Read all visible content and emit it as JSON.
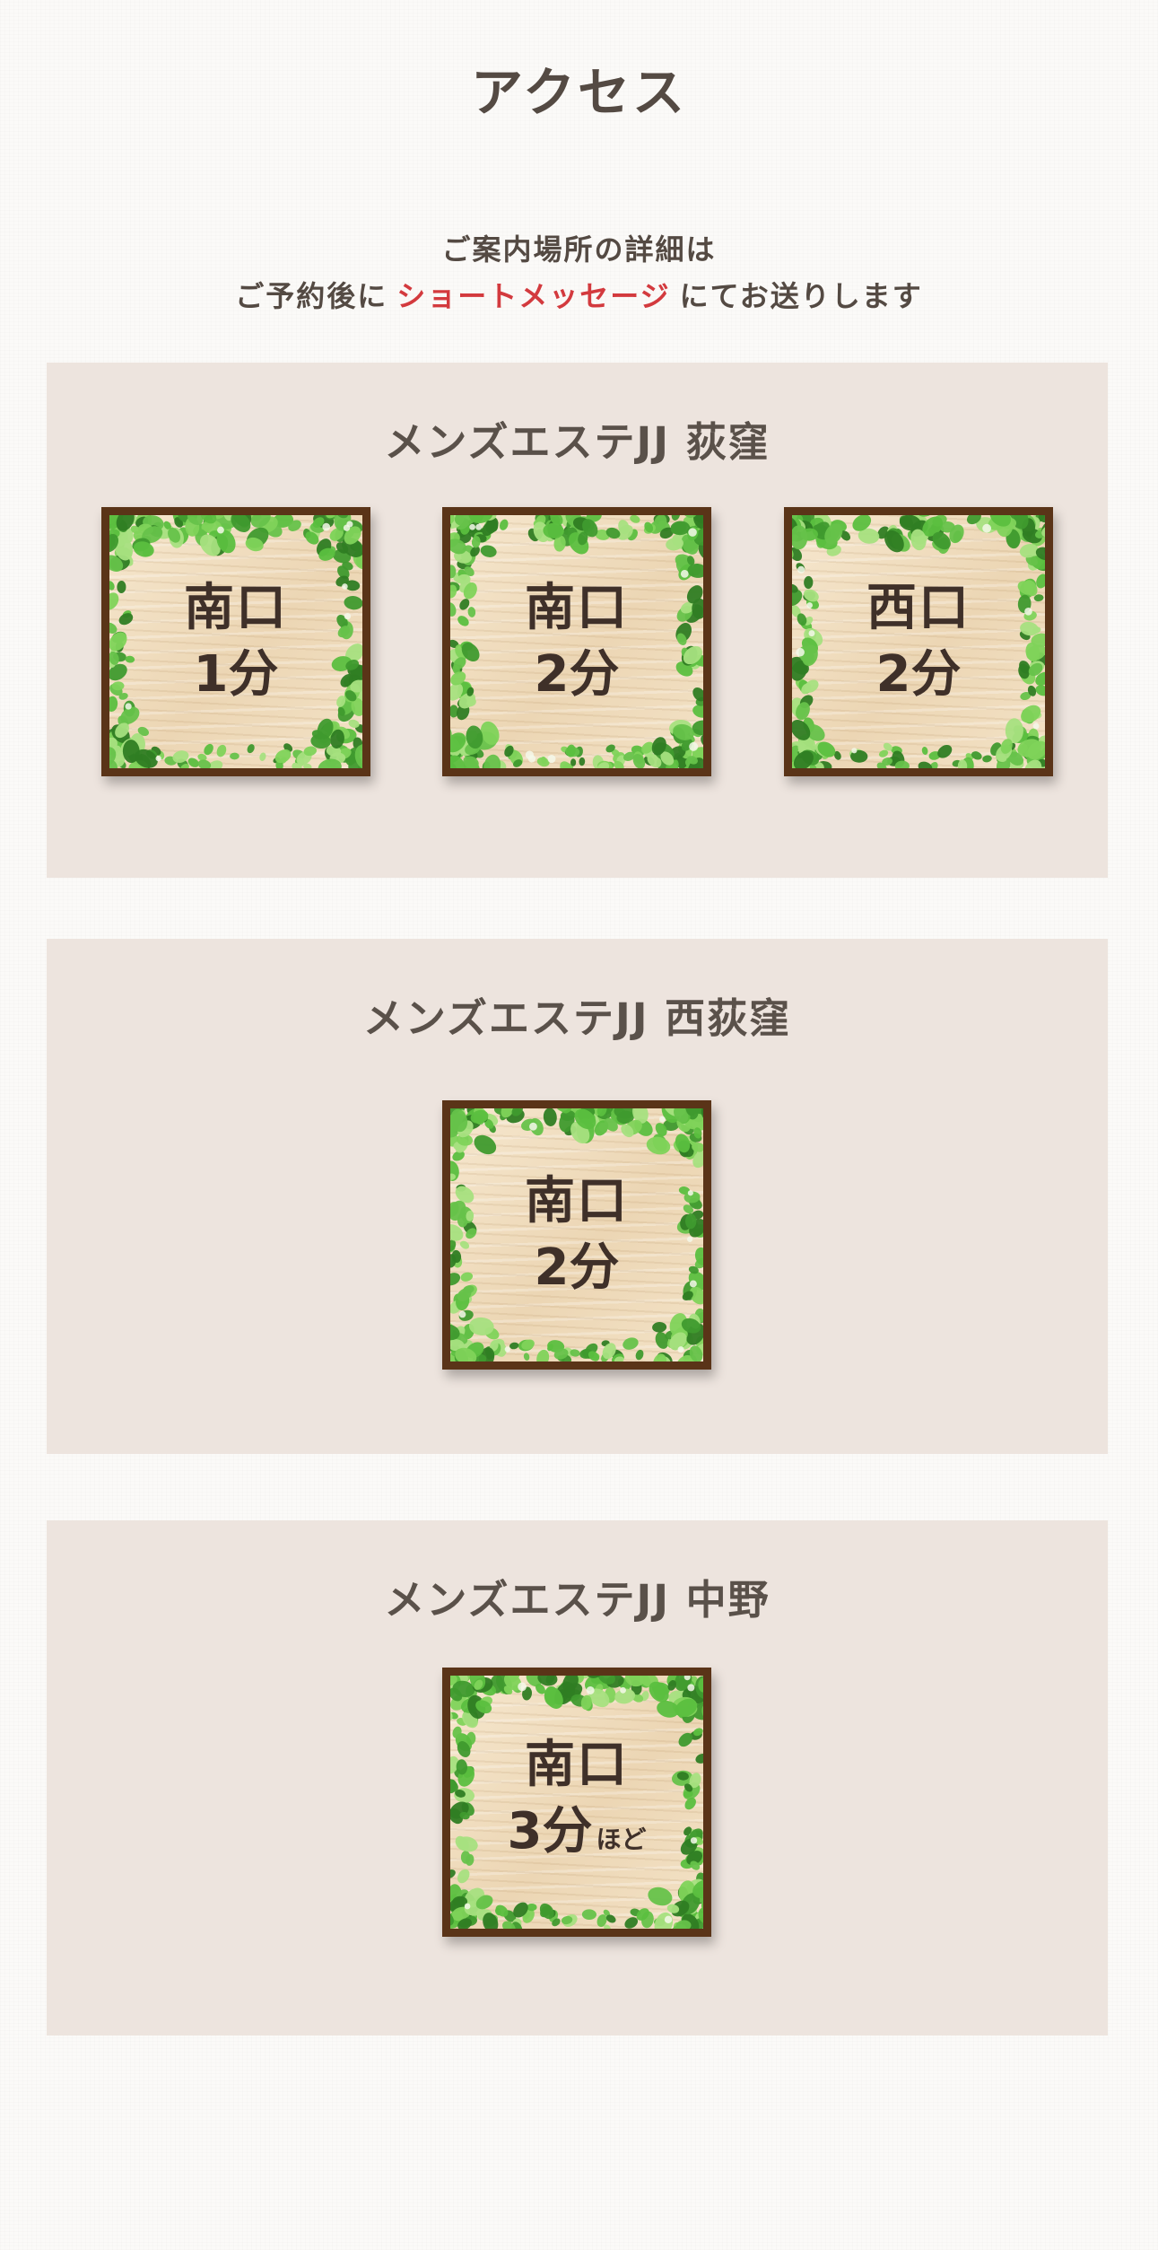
{
  "page": {
    "title": "アクセス"
  },
  "intro": {
    "line1": "ご案内場所の詳細は",
    "line2_prefix": "ご予約後に",
    "line2_highlight": "ショートメッセージ",
    "line2_suffix": "にてお送りします",
    "highlight_color": "#d33a3e"
  },
  "stores": [
    {
      "name": "メンズエステJJ 荻窪",
      "signs": [
        {
          "exit": "南口",
          "time": "1分",
          "note": ""
        },
        {
          "exit": "南口",
          "time": "2分",
          "note": ""
        },
        {
          "exit": "西口",
          "time": "2分",
          "note": ""
        }
      ]
    },
    {
      "name": "メンズエステJJ 西荻窪",
      "signs": [
        {
          "exit": "南口",
          "time": "2分",
          "note": ""
        }
      ]
    },
    {
      "name": "メンズエステJJ 中野",
      "signs": [
        {
          "exit": "南口",
          "time": "3分",
          "note": "ほど"
        }
      ]
    }
  ],
  "colors": {
    "section_background": "#ede4de",
    "sign_frame": "#5a3418",
    "leaf_green": "#4caf3a"
  },
  "icons": {
    "sign_decoration": "ivy-leaf-frame-icon"
  }
}
